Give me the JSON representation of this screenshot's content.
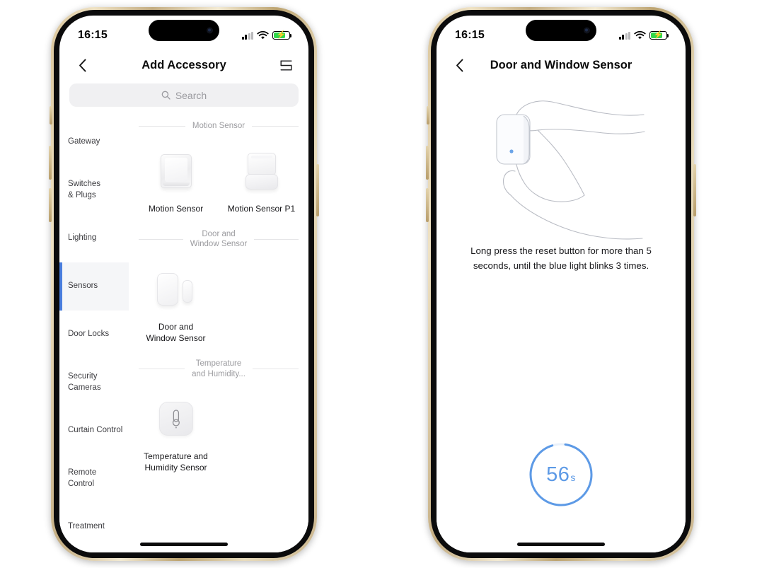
{
  "left_phone": {
    "status_bar": {
      "time": "16:15",
      "signal_bars_filled": 2,
      "signal_bars_total": 4,
      "wifi": "wifi-icon",
      "battery_charging": true,
      "battery_level_pct": 70
    },
    "nav": {
      "back_icon": "chevron-left-icon",
      "title": "Add Accessory",
      "right_icon": "list-layout-icon"
    },
    "search": {
      "placeholder": "Search",
      "icon": "search-icon"
    },
    "categories": [
      {
        "label": "Gateway",
        "active": false
      },
      {
        "label": "Switches\n& Plugs",
        "active": false
      },
      {
        "label": "Lighting",
        "active": false
      },
      {
        "label": "Sensors",
        "active": true
      },
      {
        "label": "Door Locks",
        "active": false
      },
      {
        "label": "Security\nCameras",
        "active": false
      },
      {
        "label": "Curtain Control",
        "active": false
      },
      {
        "label": "Remote\nControl",
        "active": false
      },
      {
        "label": "Treatment",
        "active": false
      }
    ],
    "sections": [
      {
        "title": "Motion Sensor",
        "products": [
          {
            "name": "Motion Sensor",
            "art": "motion"
          },
          {
            "name": "Motion Sensor P1",
            "art": "p1"
          }
        ]
      },
      {
        "title": "Door and\nWindow Sensor",
        "products": [
          {
            "name": "Door and\nWindow Sensor",
            "art": "door"
          }
        ]
      },
      {
        "title": "Temperature\nand Humidity...",
        "products": [
          {
            "name": "Temperature and\nHumidity Sensor",
            "art": "temp"
          }
        ]
      }
    ]
  },
  "right_phone": {
    "status_bar": {
      "time": "16:15",
      "signal_bars_filled": 2,
      "signal_bars_total": 4,
      "wifi": "wifi-icon",
      "battery_charging": true,
      "battery_level_pct": 70
    },
    "nav": {
      "back_icon": "chevron-left-icon",
      "title": "Door and Window Sensor"
    },
    "illustration": "hand-holding-sensor-with-blue-reset-light",
    "instruction": "Long press the reset button for more than 5 seconds, until the blue light blinks 3 times.",
    "timer": {
      "value": "56",
      "unit": "s",
      "progress_pct": 93
    }
  },
  "colors": {
    "accent_blue": "#4a7ede",
    "timer_blue": "#5d9ae6",
    "battery_green": "#32d74b",
    "frame_gold": "#d9c49a",
    "text_primary": "#17171a",
    "text_muted": "#9b9b9f"
  }
}
